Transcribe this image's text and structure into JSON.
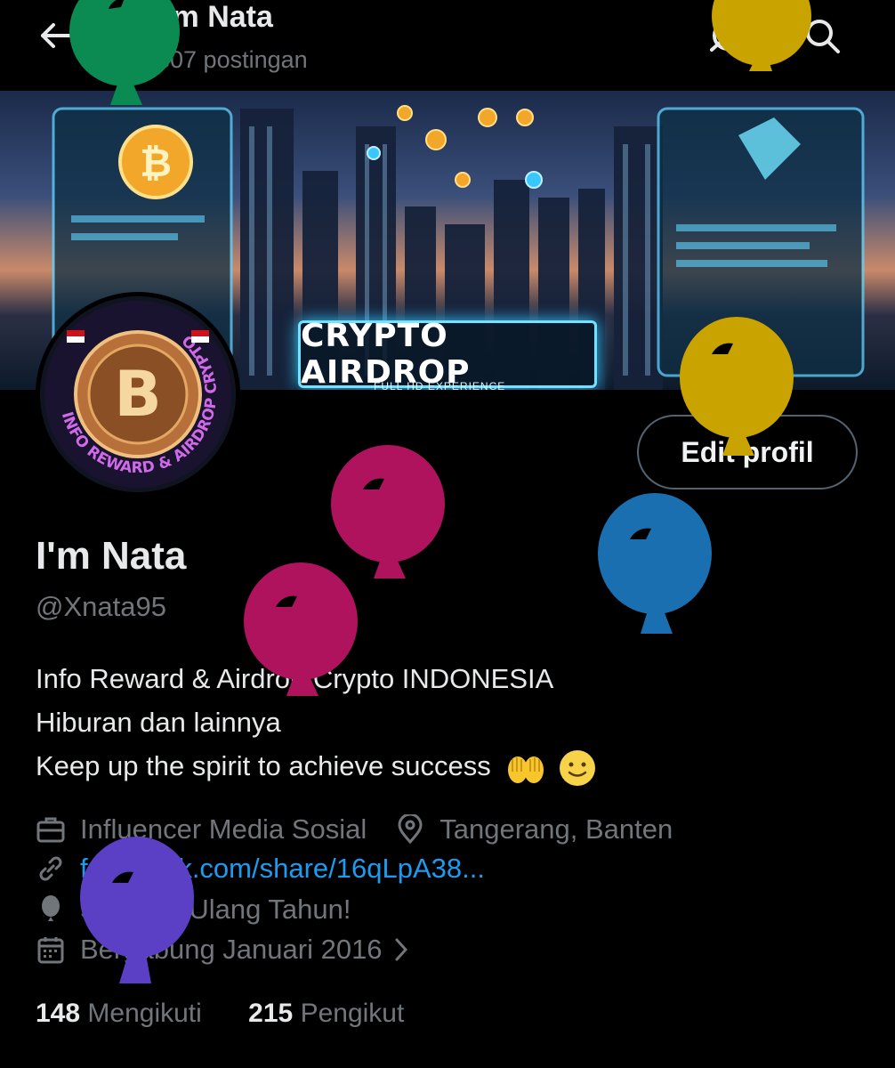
{
  "header": {
    "name": "I'm Nata",
    "post_count": "307 postingan",
    "back_icon": "arrow-left-icon",
    "grok_icon": "grok-icon",
    "search_icon": "search-icon"
  },
  "banner": {
    "title": "CRYPTO AIRDROP",
    "subtitle": "FULL HD EXPERIENCE"
  },
  "avatar": {
    "ring_text": "INFO REWARD & AIRDROP CRYPTO",
    "coin_symbol": "B"
  },
  "profile": {
    "edit_label": "Edit profil",
    "display_name": "I'm Nata",
    "handle": "@Xnata95",
    "bio_line1": "Info Reward & Airdrop Crypto INDONESIA",
    "bio_line2": "Hiburan dan lainnya",
    "bio_line3": "Keep up the spirit to achieve success"
  },
  "meta": {
    "category": "Influencer Media Sosial",
    "location": "Tangerang, Banten",
    "link": "facebook.com/share/16qLpA38...",
    "birthday": "Selamat Ulang Tahun!",
    "joined": "Bergabung Januari 2016",
    "icons": [
      "briefcase-icon",
      "location-pin-icon",
      "link-icon",
      "balloon-icon",
      "calendar-icon",
      "chevron-right-icon"
    ]
  },
  "stats": {
    "following_count": "148",
    "following_label": "Mengikuti",
    "followers_count": "215",
    "followers_label": "Pengikut"
  },
  "colors": {
    "background": "#000000",
    "text_primary": "#e7e9ea",
    "text_secondary": "#71767b",
    "link": "#1d9bf0",
    "balloon_green": "#0b8a52",
    "balloon_yellow": "#c9a300",
    "balloon_magenta": "#b0135e",
    "balloon_blue": "#1a6fb0",
    "balloon_purple": "#5b3fc4"
  }
}
